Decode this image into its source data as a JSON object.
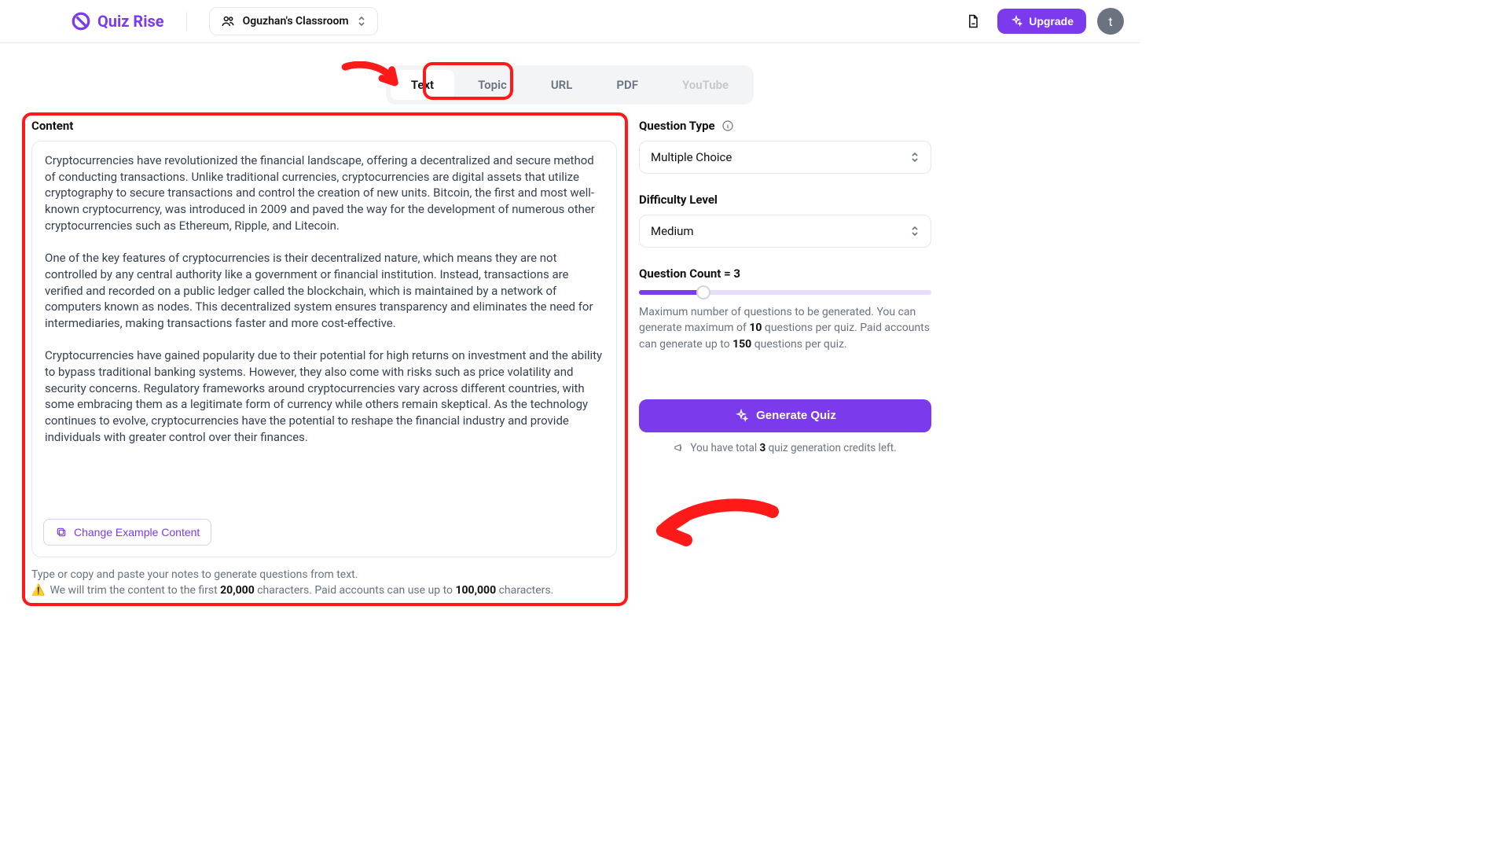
{
  "header": {
    "app_name": "Quiz Rise",
    "classroom_label": "Oguzhan's Classroom",
    "upgrade_label": "Upgrade",
    "avatar_letter": "t"
  },
  "tabs": {
    "text": "Text",
    "topic": "Topic",
    "url": "URL",
    "pdf": "PDF",
    "youtube": "YouTube"
  },
  "content": {
    "label": "Content",
    "text": "Cryptocurrencies have revolutionized the financial landscape, offering a decentralized and secure method of conducting transactions. Unlike traditional currencies, cryptocurrencies are digital assets that utilize cryptography to secure transactions and control the creation of new units. Bitcoin, the first and most well-known cryptocurrency, was introduced in 2009 and paved the way for the development of numerous other cryptocurrencies such as Ethereum, Ripple, and Litecoin.\n\nOne of the key features of cryptocurrencies is their decentralized nature, which means they are not controlled by any central authority like a government or financial institution. Instead, transactions are verified and recorded on a public ledger called the blockchain, which is maintained by a network of computers known as nodes. This decentralized system ensures transparency and eliminates the need for intermediaries, making transactions faster and more cost-effective.\n\nCryptocurrencies have gained popularity due to their potential for high returns on investment and the ability to bypass traditional banking systems. However, they also come with risks such as price volatility and security concerns. Regulatory frameworks around cryptocurrencies vary across different countries, with some embracing them as a legitimate form of currency while others remain skeptical. As the technology continues to evolve, cryptocurrencies have the potential to reshape the financial industry and provide individuals with greater control over their finances.",
    "change_label": "Change Example Content",
    "hint1": "Type or copy and paste your notes to generate questions from text.",
    "hint2_pre": "We will trim the content to the first ",
    "hint2_limit1": "20,000",
    "hint2_mid": " characters. Paid accounts can use up to ",
    "hint2_limit2": "100,000",
    "hint2_post": " characters."
  },
  "options": {
    "qtype_label": "Question Type",
    "qtype_value": "Multiple Choice",
    "diff_label": "Difficulty Level",
    "diff_value": "Medium",
    "count_label": "Question Count = 3",
    "count_help_1": "Maximum number of questions to be generated. You can generate maximum of ",
    "count_help_b1": "10",
    "count_help_2": " questions per quiz. Paid accounts can generate up to ",
    "count_help_b2": "150",
    "count_help_3": " questions per quiz.",
    "generate_label": "Generate Quiz",
    "credits_pre": "You have total ",
    "credits_num": "3",
    "credits_post": " quiz generation credits left."
  }
}
